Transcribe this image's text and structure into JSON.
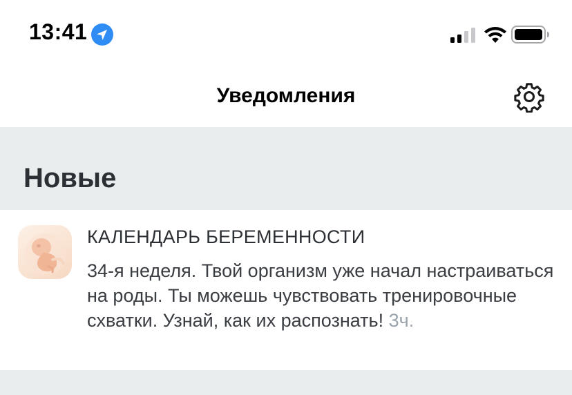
{
  "status_bar": {
    "time": "13:41",
    "icons": [
      "location-arrow-icon",
      "cellular-signal-icon",
      "wifi-icon",
      "battery-icon"
    ],
    "accent_color": "#2f8cf5"
  },
  "header": {
    "title": "Уведомления",
    "settings_icon": "gear-icon"
  },
  "section": {
    "title": "Новые"
  },
  "notifications": [
    {
      "source": "КАЛЕНДАРЬ БЕРЕМЕННОСТИ",
      "text": "34-я неделя. Твой организм уже начал настраиваться на роды. Ты можешь чувствовать тренировочные схватки. Узнай, как их распознать!",
      "time": "3ч.",
      "icon": "embryo-icon"
    }
  ],
  "colors": {
    "section_background": "#e9eded",
    "time_gray": "#9aa3ab"
  }
}
